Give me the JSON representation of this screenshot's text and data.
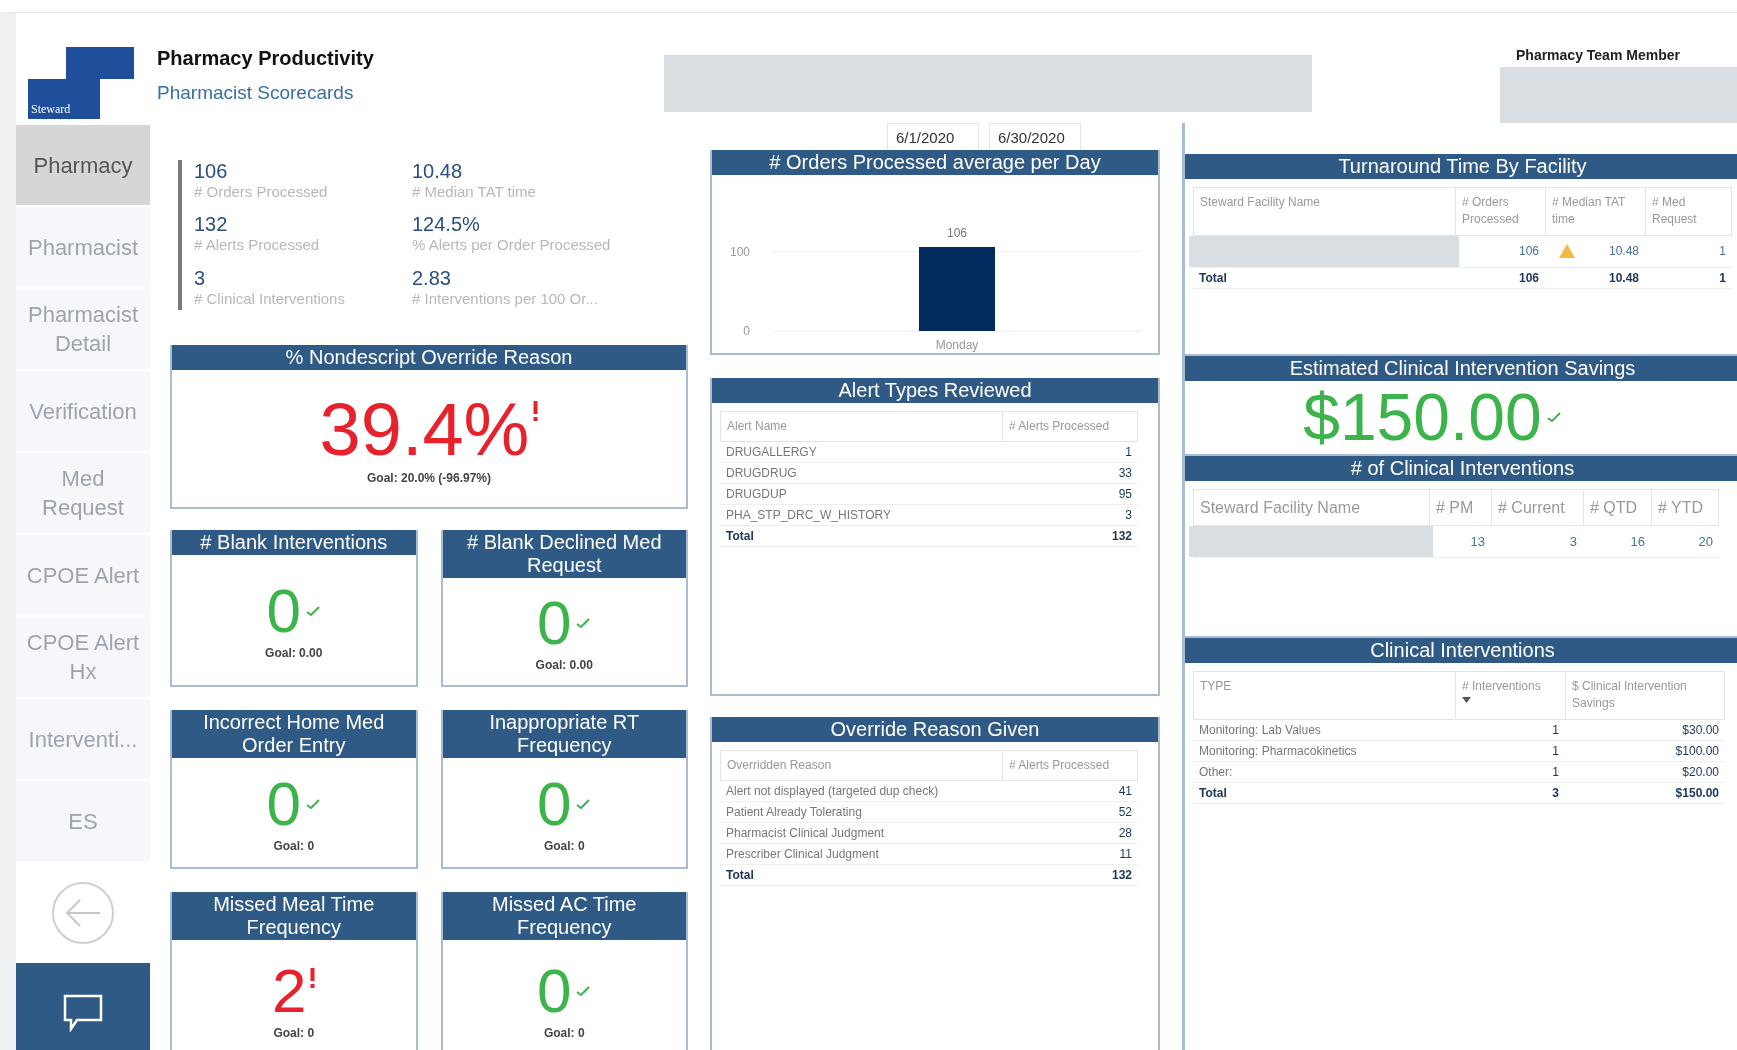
{
  "sidebar": {
    "logo_text": "Steward",
    "items": [
      {
        "label": "Pharmacy",
        "selected": true
      },
      {
        "label": "Pharmacist",
        "selected": false
      },
      {
        "label": "Pharmacist Detail",
        "selected": false
      },
      {
        "label": "Verification",
        "selected": false
      },
      {
        "label": "Med Request",
        "selected": false
      },
      {
        "label": "CPOE Alert",
        "selected": false
      },
      {
        "label": "CPOE Alert Hx",
        "selected": false
      },
      {
        "label": "Interventi...",
        "selected": false
      },
      {
        "label": "ES",
        "selected": false
      }
    ]
  },
  "header": {
    "title": "Pharmacy Productivity",
    "subtitle": "Pharmacist Scorecards",
    "team_member_label": "Pharmacy Team Member"
  },
  "date_range": {
    "start": "6/1/2020",
    "end": "6/30/2020"
  },
  "summary": [
    {
      "value": "106",
      "label": "# Orders Processed"
    },
    {
      "value": "10.48",
      "label": "# Median TAT time"
    },
    {
      "value": "132",
      "label": "# Alerts Processed"
    },
    {
      "value": "124.5%",
      "label": "% Alerts per Order Processed"
    },
    {
      "value": "3",
      "label": "# Clinical Interventions"
    },
    {
      "value": "2.83",
      "label": "# Interventions per 100 Or..."
    }
  ],
  "kpi_cards": [
    {
      "title": "% Nondescript Override Reason",
      "value": "39.4%",
      "kind": "bad",
      "goal": "Goal: 20.0% (-96.97%)"
    },
    {
      "title": "# Blank Interventions",
      "value": "0",
      "kind": "good",
      "goal": "Goal: 0.00"
    },
    {
      "title": "# Blank Declined Med Request",
      "value": "0",
      "kind": "good",
      "goal": "Goal: 0.00"
    },
    {
      "title": "Incorrect Home Med Order Entry",
      "value": "0",
      "kind": "good",
      "goal": "Goal: 0"
    },
    {
      "title": "Inappropriate RT Frequency",
      "value": "0",
      "kind": "good",
      "goal": "Goal: 0"
    },
    {
      "title": "Missed Meal Time Frequency",
      "value": "2",
      "kind": "bad",
      "goal": "Goal: 0"
    },
    {
      "title": "Missed AC Time Frequency",
      "value": "0",
      "kind": "good",
      "goal": "Goal: 0"
    }
  ],
  "orders_chart": {
    "title": "# Orders Processed average per Day",
    "chart_data": {
      "type": "bar",
      "categories": [
        "Monday"
      ],
      "values": [
        106
      ],
      "yticks": [
        0,
        100
      ],
      "ylim": [
        0,
        106
      ],
      "data_labels": true
    }
  },
  "alert_types": {
    "title": "Alert Types Reviewed",
    "columns": [
      {
        "label": "Alert Name"
      },
      {
        "label": "# Alerts Processed"
      }
    ],
    "rows": [
      {
        "name": "DRUGALLERGY",
        "values": [
          "1"
        ]
      },
      {
        "name": "DRUGDRUG",
        "values": [
          "33"
        ]
      },
      {
        "name": "DRUGDUP",
        "values": [
          "95"
        ]
      },
      {
        "name": "PHA_STP_DRC_W_HISTORY",
        "values": [
          "3"
        ]
      }
    ],
    "total": {
      "name": "Total",
      "values": [
        "132"
      ]
    }
  },
  "override_reasons": {
    "title": "Override Reason Given",
    "columns": [
      {
        "label": "Overridden Reason"
      },
      {
        "label": "# Alerts Processed"
      }
    ],
    "rows": [
      {
        "name": "Alert not displayed (targeted dup check)",
        "values": [
          "41"
        ]
      },
      {
        "name": "Patient Already Tolerating",
        "values": [
          "52"
        ]
      },
      {
        "name": "Pharmacist Clinical Judgment",
        "values": [
          "28"
        ]
      },
      {
        "name": "Prescriber Clinical Judgment",
        "values": [
          "11"
        ]
      }
    ],
    "total": {
      "name": "Total",
      "values": [
        "132"
      ]
    }
  },
  "turnaround": {
    "title": "Turnaround Time By Facility",
    "columns": [
      {
        "label": "Steward Facility Name"
      },
      {
        "label": "# Orders Processed"
      },
      {
        "label": "# Median TAT time"
      },
      {
        "label": "# Med Request"
      }
    ],
    "rows": [
      {
        "redacted": true,
        "warning": true,
        "values": [
          "106",
          "10.48",
          "1"
        ]
      }
    ],
    "total": {
      "name": "Total",
      "values": [
        "106",
        "10.48",
        "1"
      ]
    }
  },
  "savings": {
    "title": "Estimated Clinical Intervention Savings",
    "value": "$150.00",
    "kind": "good"
  },
  "intervention_counts": {
    "title": "# of Clinical Interventions",
    "columns": [
      {
        "label": "Steward Facility Name"
      },
      {
        "label": "# PM"
      },
      {
        "label": "# Current"
      },
      {
        "label": "# QTD"
      },
      {
        "label": "# YTD"
      }
    ],
    "rows": [
      {
        "redacted": true,
        "warning": false,
        "values": [
          "13",
          "3",
          "16",
          "20"
        ]
      }
    ]
  },
  "clinical_interventions": {
    "title": "Clinical Interventions",
    "columns": [
      {
        "label": "TYPE",
        "sorted": false
      },
      {
        "label": "# Interventions",
        "sorted": true
      },
      {
        "label": "$ Clinical Intervention Savings",
        "sorted": false
      }
    ],
    "rows": [
      {
        "name": "Monitoring: Lab Values",
        "values": [
          "1",
          "$30.00"
        ]
      },
      {
        "name": "Monitoring: Pharmacokinetics",
        "values": [
          "1",
          "$100.00"
        ]
      },
      {
        "name": "Other:",
        "values": [
          "1",
          "$20.00"
        ]
      }
    ],
    "total": {
      "name": "Total",
      "values": [
        "3",
        "$150.00"
      ]
    }
  }
}
